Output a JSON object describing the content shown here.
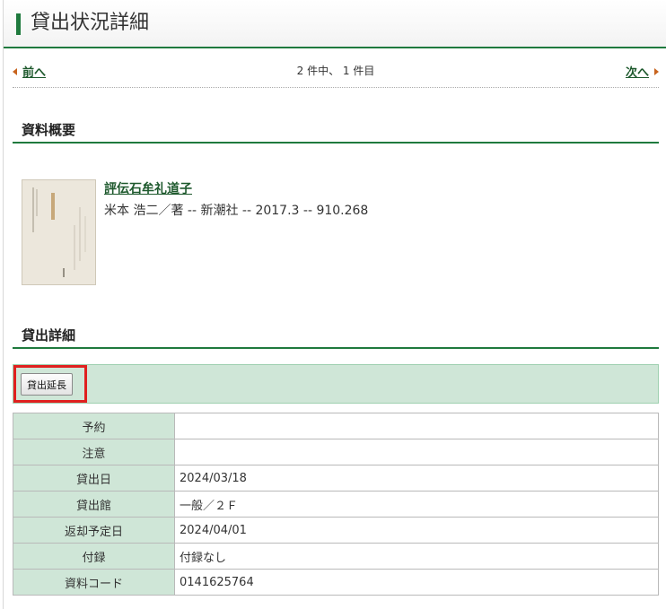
{
  "header": {
    "title": "貸出状況詳細"
  },
  "pager": {
    "prev_label": "前へ",
    "next_label": "次へ",
    "count_text": "2 件中、 1 件目"
  },
  "overview": {
    "heading": "資料概要",
    "book": {
      "title": "評伝石牟礼道子",
      "meta": "米本 浩二／著 -- 新潮社 -- 2017.3 -- 910.268",
      "cover_text": "評伝 石牟礼道子"
    }
  },
  "loan": {
    "heading": "貸出詳細",
    "extend_button_label": "貸出延長",
    "rows": [
      {
        "label": "予約",
        "value": ""
      },
      {
        "label": "注意",
        "value": ""
      },
      {
        "label": "貸出日",
        "value": "2024/03/18"
      },
      {
        "label": "貸出館",
        "value": "一般／２Ｆ"
      },
      {
        "label": "返却予定日",
        "value": "2024/04/01"
      },
      {
        "label": "付録",
        "value": "付録なし"
      },
      {
        "label": "資料コード",
        "value": "0141625764"
      }
    ]
  },
  "colors": {
    "accent_green": "#1f7a3e",
    "label_bg": "#cfe6d7",
    "highlight_red": "#e0201f",
    "arrow_orange": "#c8641e"
  }
}
